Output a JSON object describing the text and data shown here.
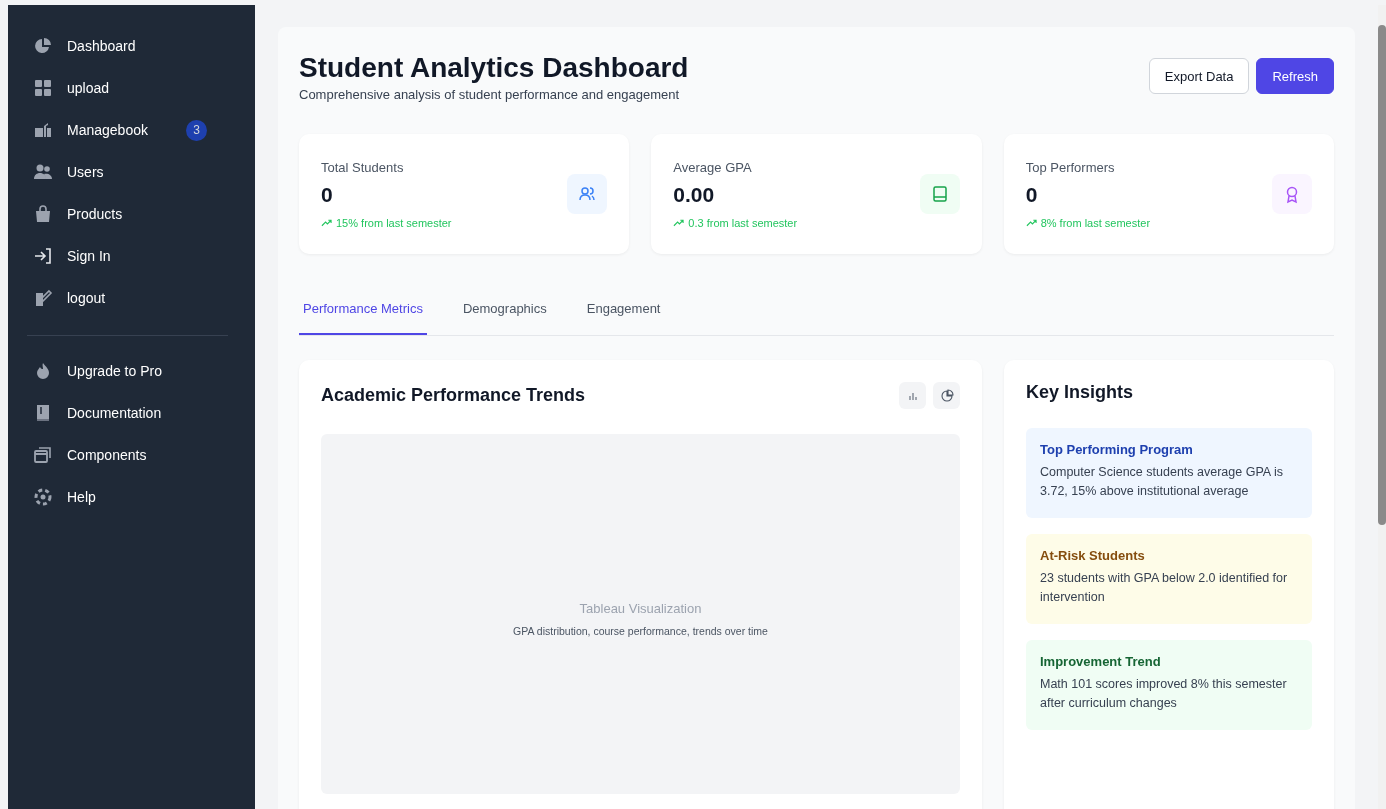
{
  "sidebar": {
    "items": [
      {
        "label": "Dashboard"
      },
      {
        "label": "upload"
      },
      {
        "label": "Managebook",
        "badge": "3"
      },
      {
        "label": "Users"
      },
      {
        "label": "Products"
      },
      {
        "label": "Sign In"
      },
      {
        "label": "logout"
      }
    ],
    "secondary": [
      {
        "label": "Upgrade to Pro"
      },
      {
        "label": "Documentation"
      },
      {
        "label": "Components"
      },
      {
        "label": "Help"
      }
    ]
  },
  "header": {
    "title": "Student Analytics Dashboard",
    "subtitle": "Comprehensive analysis of student performance and engagement",
    "buttons": [
      {
        "label": "Export Data",
        "kind": "secondary"
      },
      {
        "label": "Refresh",
        "kind": "primary"
      }
    ]
  },
  "stats": [
    {
      "label": "Total Students",
      "value": "0",
      "change": "15% from last semester"
    },
    {
      "label": "Average GPA",
      "value": "0.00",
      "change": "0.3 from last semester"
    },
    {
      "label": "Top Performers",
      "value": "0",
      "change": "8% from last semester"
    }
  ],
  "tabs": [
    {
      "label": "Performance Metrics",
      "selected": true
    },
    {
      "label": "Demographics",
      "selected": false
    },
    {
      "label": "Engagement",
      "selected": false
    }
  ],
  "chart_panel": {
    "title": "Academic Performance Trends",
    "placeholder_title": "Tableau Visualization",
    "placeholder_text": "GPA distribution, course performance, trends over time"
  },
  "insights": {
    "title": "Key Insights",
    "items": [
      {
        "kind": "info",
        "title": "Top Performing Program",
        "text": "Computer Science students average GPA is 3.72, 15% above institutional average"
      },
      {
        "kind": "warning",
        "title": "At-Risk Students",
        "text": "23 students with GPA below 2.0 identified for intervention"
      },
      {
        "kind": "success",
        "title": "Improvement Trend",
        "text": "Math 101 scores improved 8% this semester after curriculum changes"
      }
    ]
  }
}
